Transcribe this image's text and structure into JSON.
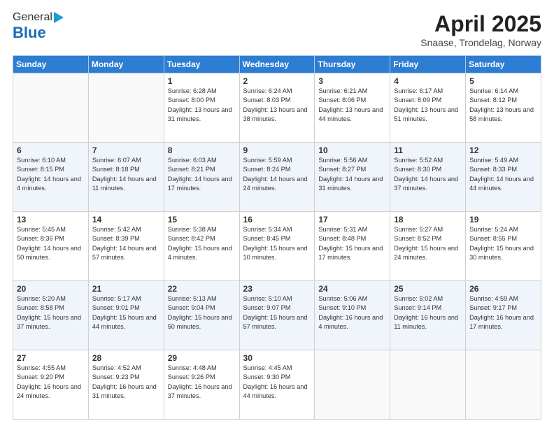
{
  "header": {
    "logo_general": "General",
    "logo_blue": "Blue",
    "title": "April 2025",
    "subtitle": "Snaase, Trondelag, Norway"
  },
  "weekdays": [
    "Sunday",
    "Monday",
    "Tuesday",
    "Wednesday",
    "Thursday",
    "Friday",
    "Saturday"
  ],
  "weeks": [
    [
      {
        "day": "",
        "sunrise": "",
        "sunset": "",
        "daylight": ""
      },
      {
        "day": "",
        "sunrise": "",
        "sunset": "",
        "daylight": ""
      },
      {
        "day": "1",
        "sunrise": "Sunrise: 6:28 AM",
        "sunset": "Sunset: 8:00 PM",
        "daylight": "Daylight: 13 hours and 31 minutes."
      },
      {
        "day": "2",
        "sunrise": "Sunrise: 6:24 AM",
        "sunset": "Sunset: 8:03 PM",
        "daylight": "Daylight: 13 hours and 38 minutes."
      },
      {
        "day": "3",
        "sunrise": "Sunrise: 6:21 AM",
        "sunset": "Sunset: 8:06 PM",
        "daylight": "Daylight: 13 hours and 44 minutes."
      },
      {
        "day": "4",
        "sunrise": "Sunrise: 6:17 AM",
        "sunset": "Sunset: 8:09 PM",
        "daylight": "Daylight: 13 hours and 51 minutes."
      },
      {
        "day": "5",
        "sunrise": "Sunrise: 6:14 AM",
        "sunset": "Sunset: 8:12 PM",
        "daylight": "Daylight: 13 hours and 58 minutes."
      }
    ],
    [
      {
        "day": "6",
        "sunrise": "Sunrise: 6:10 AM",
        "sunset": "Sunset: 8:15 PM",
        "daylight": "Daylight: 14 hours and 4 minutes."
      },
      {
        "day": "7",
        "sunrise": "Sunrise: 6:07 AM",
        "sunset": "Sunset: 8:18 PM",
        "daylight": "Daylight: 14 hours and 11 minutes."
      },
      {
        "day": "8",
        "sunrise": "Sunrise: 6:03 AM",
        "sunset": "Sunset: 8:21 PM",
        "daylight": "Daylight: 14 hours and 17 minutes."
      },
      {
        "day": "9",
        "sunrise": "Sunrise: 5:59 AM",
        "sunset": "Sunset: 8:24 PM",
        "daylight": "Daylight: 14 hours and 24 minutes."
      },
      {
        "day": "10",
        "sunrise": "Sunrise: 5:56 AM",
        "sunset": "Sunset: 8:27 PM",
        "daylight": "Daylight: 14 hours and 31 minutes."
      },
      {
        "day": "11",
        "sunrise": "Sunrise: 5:52 AM",
        "sunset": "Sunset: 8:30 PM",
        "daylight": "Daylight: 14 hours and 37 minutes."
      },
      {
        "day": "12",
        "sunrise": "Sunrise: 5:49 AM",
        "sunset": "Sunset: 8:33 PM",
        "daylight": "Daylight: 14 hours and 44 minutes."
      }
    ],
    [
      {
        "day": "13",
        "sunrise": "Sunrise: 5:45 AM",
        "sunset": "Sunset: 8:36 PM",
        "daylight": "Daylight: 14 hours and 50 minutes."
      },
      {
        "day": "14",
        "sunrise": "Sunrise: 5:42 AM",
        "sunset": "Sunset: 8:39 PM",
        "daylight": "Daylight: 14 hours and 57 minutes."
      },
      {
        "day": "15",
        "sunrise": "Sunrise: 5:38 AM",
        "sunset": "Sunset: 8:42 PM",
        "daylight": "Daylight: 15 hours and 4 minutes."
      },
      {
        "day": "16",
        "sunrise": "Sunrise: 5:34 AM",
        "sunset": "Sunset: 8:45 PM",
        "daylight": "Daylight: 15 hours and 10 minutes."
      },
      {
        "day": "17",
        "sunrise": "Sunrise: 5:31 AM",
        "sunset": "Sunset: 8:48 PM",
        "daylight": "Daylight: 15 hours and 17 minutes."
      },
      {
        "day": "18",
        "sunrise": "Sunrise: 5:27 AM",
        "sunset": "Sunset: 8:52 PM",
        "daylight": "Daylight: 15 hours and 24 minutes."
      },
      {
        "day": "19",
        "sunrise": "Sunrise: 5:24 AM",
        "sunset": "Sunset: 8:55 PM",
        "daylight": "Daylight: 15 hours and 30 minutes."
      }
    ],
    [
      {
        "day": "20",
        "sunrise": "Sunrise: 5:20 AM",
        "sunset": "Sunset: 8:58 PM",
        "daylight": "Daylight: 15 hours and 37 minutes."
      },
      {
        "day": "21",
        "sunrise": "Sunrise: 5:17 AM",
        "sunset": "Sunset: 9:01 PM",
        "daylight": "Daylight: 15 hours and 44 minutes."
      },
      {
        "day": "22",
        "sunrise": "Sunrise: 5:13 AM",
        "sunset": "Sunset: 9:04 PM",
        "daylight": "Daylight: 15 hours and 50 minutes."
      },
      {
        "day": "23",
        "sunrise": "Sunrise: 5:10 AM",
        "sunset": "Sunset: 9:07 PM",
        "daylight": "Daylight: 15 hours and 57 minutes."
      },
      {
        "day": "24",
        "sunrise": "Sunrise: 5:06 AM",
        "sunset": "Sunset: 9:10 PM",
        "daylight": "Daylight: 16 hours and 4 minutes."
      },
      {
        "day": "25",
        "sunrise": "Sunrise: 5:02 AM",
        "sunset": "Sunset: 9:14 PM",
        "daylight": "Daylight: 16 hours and 11 minutes."
      },
      {
        "day": "26",
        "sunrise": "Sunrise: 4:59 AM",
        "sunset": "Sunset: 9:17 PM",
        "daylight": "Daylight: 16 hours and 17 minutes."
      }
    ],
    [
      {
        "day": "27",
        "sunrise": "Sunrise: 4:55 AM",
        "sunset": "Sunset: 9:20 PM",
        "daylight": "Daylight: 16 hours and 24 minutes."
      },
      {
        "day": "28",
        "sunrise": "Sunrise: 4:52 AM",
        "sunset": "Sunset: 9:23 PM",
        "daylight": "Daylight: 16 hours and 31 minutes."
      },
      {
        "day": "29",
        "sunrise": "Sunrise: 4:48 AM",
        "sunset": "Sunset: 9:26 PM",
        "daylight": "Daylight: 16 hours and 37 minutes."
      },
      {
        "day": "30",
        "sunrise": "Sunrise: 4:45 AM",
        "sunset": "Sunset: 9:30 PM",
        "daylight": "Daylight: 16 hours and 44 minutes."
      },
      {
        "day": "",
        "sunrise": "",
        "sunset": "",
        "daylight": ""
      },
      {
        "day": "",
        "sunrise": "",
        "sunset": "",
        "daylight": ""
      },
      {
        "day": "",
        "sunrise": "",
        "sunset": "",
        "daylight": ""
      }
    ]
  ]
}
